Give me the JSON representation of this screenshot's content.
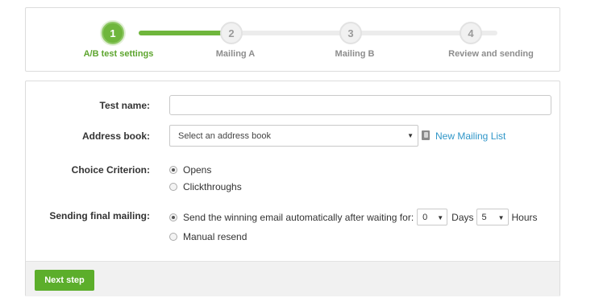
{
  "stepper": {
    "steps": [
      {
        "number": "1",
        "label": "A/B test settings",
        "active": true
      },
      {
        "number": "2",
        "label": "Mailing A",
        "active": false
      },
      {
        "number": "3",
        "label": "Mailing B",
        "active": false
      },
      {
        "number": "4",
        "label": "Review and sending",
        "active": false
      }
    ],
    "accent_color": "#6fb63c"
  },
  "form": {
    "test_name": {
      "label": "Test name:",
      "value": ""
    },
    "address_book": {
      "label": "Address book:",
      "selected": "Select an address book",
      "new_list_link": "New Mailing List",
      "link_icon": "address-book-icon"
    },
    "choice_criterion": {
      "label": "Choice Criterion:",
      "options": [
        {
          "label": "Opens",
          "checked": true
        },
        {
          "label": "Clickthroughs",
          "checked": false
        }
      ]
    },
    "sending_final": {
      "label": "Sending final mailing:",
      "auto_option": "Send the winning email automatically after waiting for:",
      "auto_checked": true,
      "days_value": "0",
      "days_label": "Days",
      "hours_value": "5",
      "hours_label": "Hours",
      "manual_option": "Manual resend",
      "manual_checked": false
    }
  },
  "footer": {
    "next_label": "Next step",
    "button_color": "#5cae2b"
  }
}
